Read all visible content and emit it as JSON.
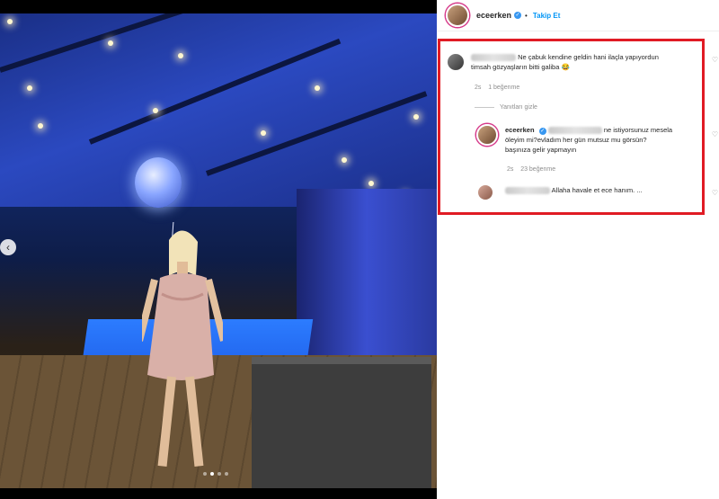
{
  "post": {
    "username": "eceerken",
    "follow_label": "Takip Et",
    "separator": "•"
  },
  "comments": [
    {
      "text_line1": "Ne çabuk kendine geldin hani ilaçla yapıyordun",
      "text_line2": "timsah gözyaşların bitti galiba 😂",
      "time": "2s",
      "likes": "1 beğenme"
    }
  ],
  "replies_toggle": "Yanıtları gizle",
  "replies": [
    {
      "username": "eceerken",
      "text_line1": "ne istiyorsunuz mesela",
      "text_line2": "öleyim mi?evladım her gün mutsuz mu görsün?",
      "text_line3": "başınıza gelir yapmayın",
      "time": "2s",
      "likes": "23 beğenme"
    },
    {
      "text": "Allaha havale et ece hanım. ..."
    }
  ],
  "icons": {
    "verified": "verified-badge-icon",
    "heart": "heart-icon",
    "nav": "chevron-left-icon"
  },
  "colors": {
    "highlight": "#e01b24",
    "link": "#0095f6",
    "verified": "#3897f0"
  },
  "carousel": {
    "total_slides": 4,
    "active_slide": 2
  }
}
